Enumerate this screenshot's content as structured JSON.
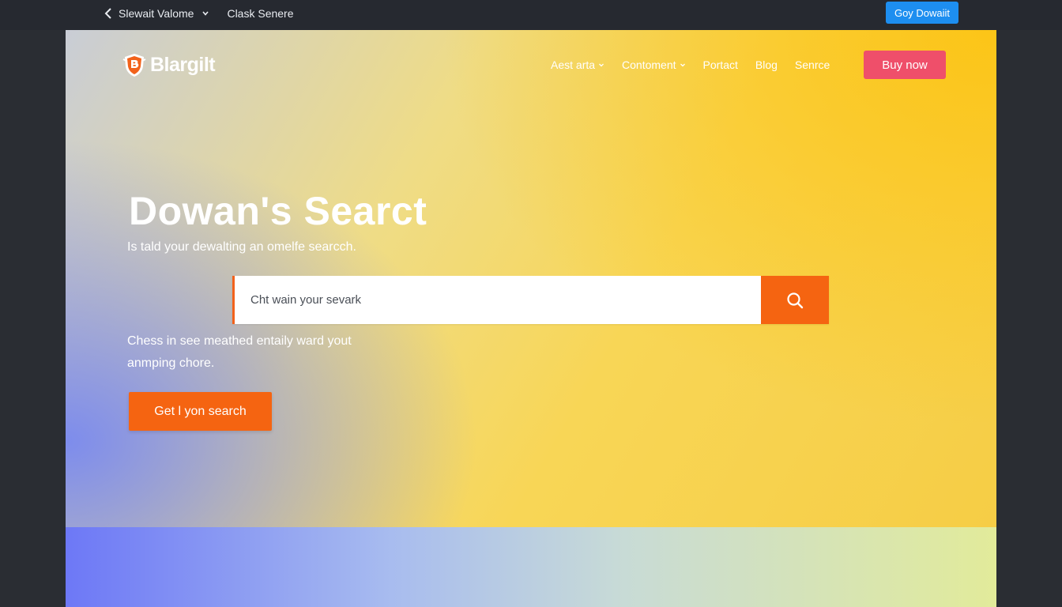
{
  "browser_bar": {
    "back_icon": "chevron-left-icon",
    "site_selector": "Slewait Valome",
    "link": "Clask Senere",
    "cta_label": "Goy Dowaiit"
  },
  "header": {
    "logo_text": "Blargilt",
    "logo_icon": "shield-logo-icon",
    "nav": [
      {
        "label": "Aest arta",
        "has_dropdown": true
      },
      {
        "label": "Contoment",
        "has_dropdown": true
      },
      {
        "label": "Portact",
        "has_dropdown": false
      },
      {
        "label": "Blog",
        "has_dropdown": false
      },
      {
        "label": "Senrce",
        "has_dropdown": false
      }
    ],
    "buy_label": "Buy now"
  },
  "hero": {
    "title": "Dowan's Searct",
    "subtitle": "Is tald your dewalting an omelfe searcch.",
    "search": {
      "placeholder": "Cht wain your sevark",
      "value": "",
      "icon": "search-icon"
    },
    "description": "Chess in see meathed entaily ward yout anmping chore.",
    "cta_label": "Get l yon search"
  },
  "colors": {
    "accent_orange": "#f56411",
    "buy_pink": "#ef4f6a",
    "top_cta_blue": "#1d8ef0",
    "hero_yellow": "#f8d656",
    "hero_violet": "#7888f0"
  }
}
